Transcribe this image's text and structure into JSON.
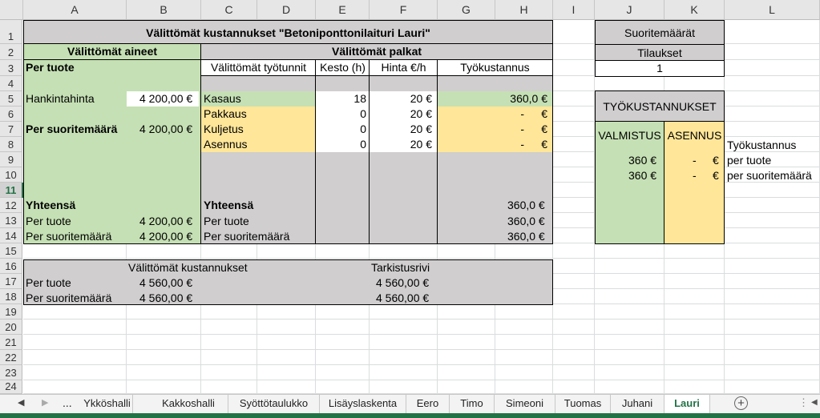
{
  "columns": [
    "A",
    "B",
    "C",
    "D",
    "E",
    "F",
    "G",
    "H",
    "I",
    "J",
    "K",
    "L"
  ],
  "rows": [
    "1",
    "2",
    "3",
    "4",
    "5",
    "6",
    "7",
    "8",
    "9",
    "10",
    "11",
    "12",
    "13",
    "14",
    "15",
    "16",
    "17",
    "18",
    "19",
    "20",
    "21",
    "22",
    "23",
    "24"
  ],
  "title": "Välittömät kustannukset \"Betoniponttonilaituri Lauri\"",
  "aineet": {
    "header": "Välittömät aineet",
    "per_tuote": "Per tuote",
    "hankintahinta_label": "Hankintahinta",
    "hankintahinta_value": "4 200,00 €",
    "per_suoritemaara_label": "Per suoritemäärä",
    "per_suoritemaara_value": "4 200,00 €",
    "yhteensa": "Yhteensä",
    "sum_per_tuote_label": "Per tuote",
    "sum_per_tuote_value": "4 200,00 €",
    "sum_per_suoritemaara_label": "Per suoritemäärä",
    "sum_per_suoritemaara_value": "4 200,00 €"
  },
  "palkat": {
    "header": "Välittömät palkat",
    "col_tyotunnit": "Välittömät työtunnit",
    "col_kesto": "Kesto (h)",
    "col_hinta": "Hinta €/h",
    "col_tyokustannus": "Työkustannus",
    "rows": [
      {
        "name": "Kasaus",
        "kesto": "18",
        "hinta": "20 €",
        "cost": "360,0 €"
      },
      {
        "name": "Pakkaus",
        "kesto": "0",
        "hinta": "20 €",
        "cost": "-",
        "cost_unit": "€"
      },
      {
        "name": "Kuljetus",
        "kesto": "0",
        "hinta": "20 €",
        "cost": "-",
        "cost_unit": "€"
      },
      {
        "name": "Asennus",
        "kesto": "0",
        "hinta": "20 €",
        "cost": "-",
        "cost_unit": "€"
      }
    ],
    "yhteensa": "Yhteensä",
    "yhteensa_value": "360,0 €",
    "sum_per_tuote_label": "Per tuote",
    "sum_per_tuote_value": "360,0 €",
    "sum_per_suoritemaara_label": "Per suoritemäärä",
    "sum_per_suoritemaara_value": "360,0 €"
  },
  "summary": {
    "header": "Välittömät kustannukset",
    "tarkistus_header": "Tarkistusrivi",
    "per_tuote_label": "Per tuote",
    "per_tuote_value": "4 560,00 €",
    "per_tuote_check": "4 560,00 €",
    "per_suoritemaara_label": "Per suoritemäärä",
    "per_suoritemaara_value": "4 560,00 €",
    "per_suoritemaara_check": "4 560,00 €"
  },
  "suorite": {
    "header": "Suoritemäärät",
    "tilaukset_label": "Tilaukset",
    "tilaukset_value": "1"
  },
  "tyokustannukset": {
    "header": "TYÖKUSTANNUKSET",
    "valmistus": "VALMISTUS",
    "asennus": "ASENNUS",
    "valmistus_per_tuote": "360 €",
    "valmistus_per_suorite": "360 €",
    "asennus_per_tuote": "-",
    "asennus_per_suorite": "-",
    "asennus_unit": "€",
    "label_tyokustannus": "Työkustannus",
    "label_per_tuote": "per tuote",
    "label_per_suoritemaara": "per suoritemäärä"
  },
  "tabs": {
    "ellipsis": "...",
    "items": [
      "Ykköshalli",
      "Kakkoshalli",
      "Syöttötaulukko",
      "Lisäyslaskenta",
      "Eero",
      "Timo",
      "Simeoni",
      "Tuomas",
      "Juhani",
      "Lauri"
    ],
    "active": "Lauri"
  },
  "colors": {
    "green": "#c5e0b4",
    "yellow": "#ffe699",
    "gray": "#d0cece",
    "excel_green": "#217346"
  }
}
